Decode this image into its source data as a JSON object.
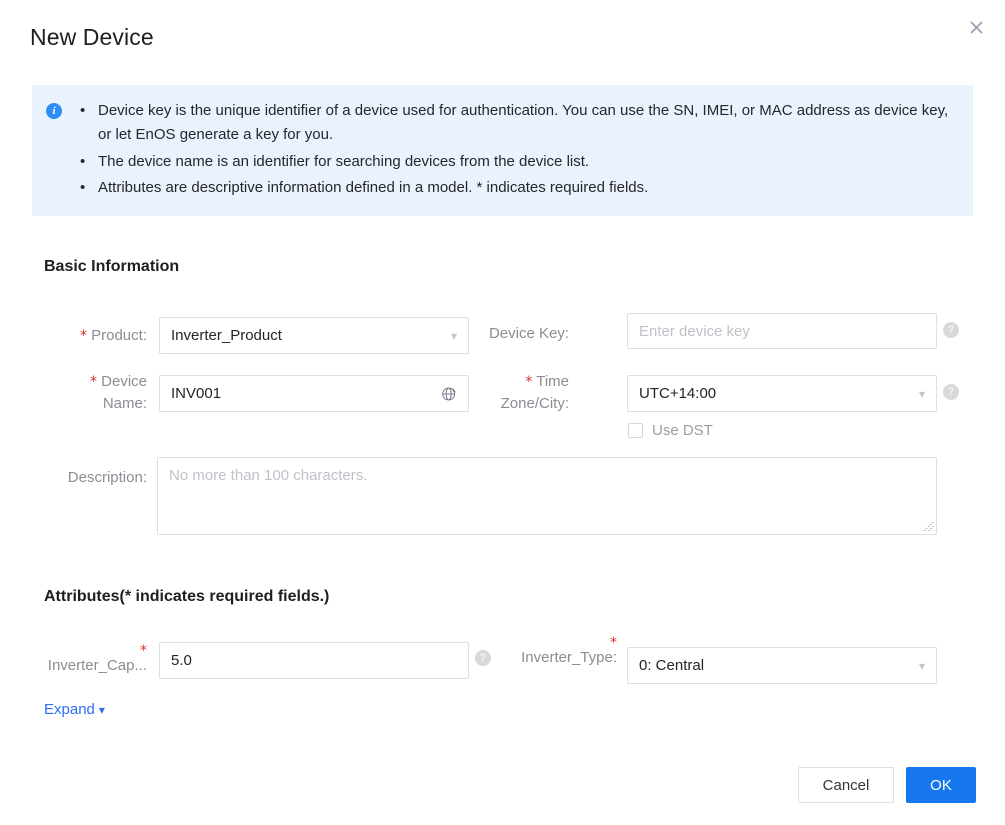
{
  "dialog": {
    "title": "New Device",
    "close_icon": "close-icon"
  },
  "info_banner": {
    "icon": "info-circle-icon",
    "items": [
      "Device key is the unique identifier of a device used for authentication. You can use the SN, IMEI, or MAC address as device key, or let EnOS generate a key for you.",
      "The device name is an identifier for searching devices from the device list.",
      "Attributes are descriptive information defined in a model. * indicates required fields."
    ]
  },
  "basic_information": {
    "heading": "Basic Information",
    "product": {
      "label": "Product:",
      "required": "*",
      "value": "Inverter_Product",
      "chevron_icon": "chevron-down-icon"
    },
    "device_name": {
      "label_line1": "Device",
      "label_line2": "Name:",
      "required": "*",
      "value": "INV001",
      "globe_icon": "globe-i18n-icon"
    },
    "device_key": {
      "label": "Device Key:",
      "value": "",
      "placeholder": "Enter device key",
      "help_icon": "question-mark-icon",
      "help_glyph": "?"
    },
    "time_zone": {
      "label_line1": "Time",
      "label_line2": "Zone/City:",
      "required": "*",
      "value": "UTC+14:00",
      "chevron_icon": "chevron-down-icon",
      "help_icon": "question-mark-icon",
      "help_glyph": "?"
    },
    "use_dst": {
      "label": "Use DST",
      "checked": false
    },
    "description": {
      "label": "Description:",
      "value": "",
      "placeholder": "No more than 100 characters."
    }
  },
  "attributes": {
    "heading": "Attributes(* indicates required fields.)",
    "inverter_capacity": {
      "label": "Inverter_Cap...",
      "required": "*",
      "value": "5.0",
      "help_icon": "question-mark-icon",
      "help_glyph": "?"
    },
    "inverter_type": {
      "label": "Inverter_Type:",
      "required": "*",
      "value": "0: Central",
      "chevron_icon": "chevron-down-icon"
    },
    "expand": {
      "label": "Expand",
      "chevron_icon": "chevron-down-icon"
    }
  },
  "footer": {
    "cancel_label": "Cancel",
    "ok_label": "OK"
  },
  "colors": {
    "primary": "#1677ef",
    "banner_bg": "#e9f2fd",
    "info_icon": "#2f8ef4",
    "required_star": "#d93026",
    "link": "#2a6ef5",
    "label_text": "#8a8d93",
    "border": "#dcdfe4"
  }
}
